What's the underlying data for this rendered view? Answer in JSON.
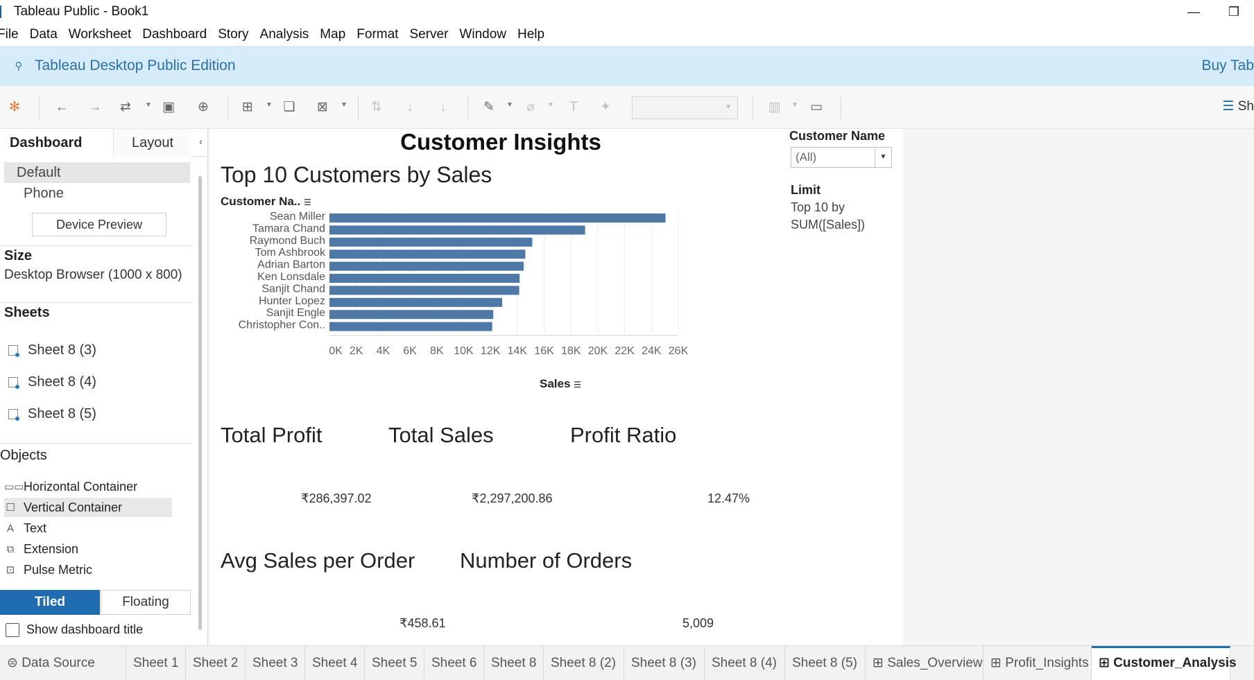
{
  "window": {
    "title": "Tableau Public - Book1"
  },
  "menu": [
    "File",
    "Data",
    "Worksheet",
    "Dashboard",
    "Story",
    "Analysis",
    "Map",
    "Format",
    "Server",
    "Window",
    "Help"
  ],
  "banner": {
    "edition": "Tableau Desktop Public Edition",
    "buy": "Buy Tab"
  },
  "toolbar": {
    "show_me": "Sh"
  },
  "left_panel": {
    "tab_dashboard": "Dashboard",
    "tab_layout": "Layout",
    "device_default": "Default",
    "device_phone": "Phone",
    "device_preview": "Device Preview",
    "size_heading": "Size",
    "size_value": "Desktop Browser (1000 x 800)",
    "sheets_heading": "Sheets",
    "sheets": [
      "Sheet 8 (3)",
      "Sheet 8 (4)",
      "Sheet 8 (5)"
    ],
    "objects_heading": "Objects",
    "objects": [
      {
        "label": "Horizontal Container",
        "icon": "horizontal-container-icon"
      },
      {
        "label": "Vertical Container",
        "icon": "vertical-container-icon"
      },
      {
        "label": "Text",
        "icon": "text-icon"
      },
      {
        "label": "Extension",
        "icon": "extension-icon"
      },
      {
        "label": "Pulse Metric",
        "icon": "pulse-metric-icon"
      }
    ],
    "tiled": "Tiled",
    "floating": "Floating",
    "show_title": "Show dashboard title"
  },
  "dashboard": {
    "title": "Customer Insights",
    "chart_title": "Top 10 Customers by Sales",
    "customer_header": "Customer Na..",
    "sales_axis_label": "Sales",
    "kpis": {
      "total_profit_label": "Total Profit",
      "total_profit_value": "₹286,397.02",
      "total_sales_label": "Total Sales",
      "total_sales_value": "₹2,297,200.86",
      "profit_ratio_label": "Profit Ratio",
      "profit_ratio_value": "12.47%",
      "avg_sales_label": "Avg Sales per Order",
      "avg_sales_value": "₹458.61",
      "orders_label": "Number of Orders",
      "orders_value": "5,009"
    },
    "filter": {
      "heading": "Customer Name",
      "value": "(All)",
      "limit_heading": "Limit",
      "limit_line1": "Top 10 by",
      "limit_line2": "SUM([Sales])"
    }
  },
  "chart_data": {
    "type": "bar",
    "orientation": "horizontal",
    "title": "Top 10 Customers by Sales",
    "xlabel": "Sales",
    "ylabel": "Customer Na..",
    "categories": [
      "Sean Miller",
      "Tamara Chand",
      "Raymond Buch",
      "Tom Ashbrook",
      "Adrian Barton",
      "Ken Lonsdale",
      "Sanjit Chand",
      "Hunter Lopez",
      "Sanjit Engle",
      "Christopher Con.."
    ],
    "values": [
      25043,
      19052,
      15117,
      14596,
      14474,
      14175,
      14142,
      12873,
      12209,
      12129
    ],
    "xlim": [
      0,
      26000
    ],
    "x_ticks": [
      "0K",
      "2K",
      "4K",
      "6K",
      "8K",
      "10K",
      "12K",
      "14K",
      "16K",
      "18K",
      "20K",
      "22K",
      "24K",
      "26K"
    ],
    "bar_color": "#4e79a7",
    "grid": true
  },
  "sheet_tabs": [
    "Data Source",
    "Sheet 1",
    "Sheet 2",
    "Sheet 3",
    "Sheet 4",
    "Sheet 5",
    "Sheet 6",
    "Sheet 8",
    "Sheet 8 (2)",
    "Sheet 8 (3)",
    "Sheet 8 (4)",
    "Sheet 8 (5)",
    "Sales_Overview",
    "Profit_Insights",
    "Customer_Analysis"
  ],
  "active_tab": "Customer_Analysis"
}
